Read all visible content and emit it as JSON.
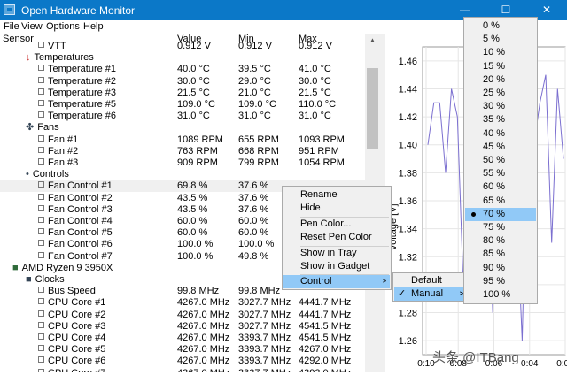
{
  "window": {
    "title": "Open Hardware Monitor",
    "minimize": "—",
    "maximize": "☐",
    "close": "✕"
  },
  "menu": [
    "File",
    "View",
    "Options",
    "Help"
  ],
  "columns": {
    "sensor": "Sensor",
    "value": "Value",
    "min": "Min",
    "max": "Max"
  },
  "rows": [
    {
      "label": "VTT",
      "value": "0.912 V",
      "min": "0.912 V",
      "max": "0.912 V",
      "kind": "leaf"
    },
    {
      "label": "Temperatures",
      "value": "",
      "min": "",
      "max": "",
      "kind": "group",
      "icon": "thermometer-icon"
    },
    {
      "label": "Temperature #1",
      "value": "40.0 °C",
      "min": "39.5 °C",
      "max": "41.0 °C",
      "kind": "leaf"
    },
    {
      "label": "Temperature #2",
      "value": "30.0 °C",
      "min": "29.0 °C",
      "max": "30.0 °C",
      "kind": "leaf"
    },
    {
      "label": "Temperature #3",
      "value": "21.5 °C",
      "min": "21.0 °C",
      "max": "21.5 °C",
      "kind": "leaf"
    },
    {
      "label": "Temperature #5",
      "value": "109.0 °C",
      "min": "109.0 °C",
      "max": "110.0 °C",
      "kind": "leaf"
    },
    {
      "label": "Temperature #6",
      "value": "31.0 °C",
      "min": "31.0 °C",
      "max": "31.0 °C",
      "kind": "leaf"
    },
    {
      "label": "Fans",
      "value": "",
      "min": "",
      "max": "",
      "kind": "group",
      "icon": "fan-icon"
    },
    {
      "label": "Fan #1",
      "value": "1089 RPM",
      "min": "655 RPM",
      "max": "1093 RPM",
      "kind": "leaf"
    },
    {
      "label": "Fan #2",
      "value": "763 RPM",
      "min": "668 RPM",
      "max": "951 RPM",
      "kind": "leaf"
    },
    {
      "label": "Fan #3",
      "value": "909 RPM",
      "min": "799 RPM",
      "max": "1054 RPM",
      "kind": "leaf"
    },
    {
      "label": "Controls",
      "value": "",
      "min": "",
      "max": "",
      "kind": "group",
      "icon": "controls-icon"
    },
    {
      "label": "Fan Control #1",
      "value": "69.8 %",
      "min": "37.6 %",
      "max": "",
      "kind": "leaf",
      "selected": true
    },
    {
      "label": "Fan Control #2",
      "value": "43.5 %",
      "min": "37.6 %",
      "max": "",
      "kind": "leaf"
    },
    {
      "label": "Fan Control #3",
      "value": "43.5 %",
      "min": "37.6 %",
      "max": "",
      "kind": "leaf"
    },
    {
      "label": "Fan Control #4",
      "value": "60.0 %",
      "min": "60.0 %",
      "max": "",
      "kind": "leaf"
    },
    {
      "label": "Fan Control #5",
      "value": "60.0 %",
      "min": "60.0 %",
      "max": "",
      "kind": "leaf"
    },
    {
      "label": "Fan Control #6",
      "value": "100.0 %",
      "min": "100.0 %",
      "max": "",
      "kind": "leaf"
    },
    {
      "label": "Fan Control #7",
      "value": "100.0 %",
      "min": "49.8 %",
      "max": "",
      "kind": "leaf"
    },
    {
      "label": "AMD Ryzen 9 3950X",
      "value": "",
      "min": "",
      "max": "",
      "kind": "device",
      "icon": "cpu-icon"
    },
    {
      "label": "Clocks",
      "value": "",
      "min": "",
      "max": "",
      "kind": "group",
      "icon": "clock-icon"
    },
    {
      "label": "Bus Speed",
      "value": "99.8 MHz",
      "min": "99.8 MHz",
      "max": "",
      "kind": "leaf"
    },
    {
      "label": "CPU Core #1",
      "value": "4267.0 MHz",
      "min": "3027.7 MHz",
      "max": "4441.7 MHz",
      "kind": "leaf"
    },
    {
      "label": "CPU Core #2",
      "value": "4267.0 MHz",
      "min": "3027.7 MHz",
      "max": "4441.7 MHz",
      "kind": "leaf"
    },
    {
      "label": "CPU Core #3",
      "value": "4267.0 MHz",
      "min": "3027.7 MHz",
      "max": "4541.5 MHz",
      "kind": "leaf"
    },
    {
      "label": "CPU Core #4",
      "value": "4267.0 MHz",
      "min": "3393.7 MHz",
      "max": "4541.5 MHz",
      "kind": "leaf"
    },
    {
      "label": "CPU Core #5",
      "value": "4267.0 MHz",
      "min": "3393.7 MHz",
      "max": "4267.0 MHz",
      "kind": "leaf"
    },
    {
      "label": "CPU Core #6",
      "value": "4267.0 MHz",
      "min": "3393.7 MHz",
      "max": "4292.0 MHz",
      "kind": "leaf"
    },
    {
      "label": "CPU Core #7",
      "value": "4267.0 MHz",
      "min": "2327.7 MHz",
      "max": "4292.0 MHz",
      "kind": "leaf"
    }
  ],
  "context_menu": {
    "items": [
      "Rename",
      "Hide",
      "Pen Color...",
      "Reset Pen Color",
      "Show in Tray",
      "Show in Gadget",
      "Control"
    ],
    "control_submenu": [
      "Default",
      "Manual"
    ],
    "manual_submenu": [
      "0 %",
      "5 %",
      "10 %",
      "15 %",
      "20 %",
      "25 %",
      "30 %",
      "35 %",
      "40 %",
      "45 %",
      "50 %",
      "55 %",
      "60 %",
      "65 %",
      "70 %",
      "75 %",
      "80 %",
      "85 %",
      "90 %",
      "95 %",
      "100 %"
    ],
    "manual_selected": "70 %"
  },
  "watermark": "头条 @ITBang",
  "colors": {
    "titlebar": "#0b78c8",
    "highlight": "#91c9f7",
    "plot_line": "#7b6fd0"
  },
  "chart_data": {
    "type": "line",
    "ylabel": "Voltage [V]",
    "yticks": [
      "1.46",
      "1.44",
      "1.42",
      "1.40",
      "1.38",
      "1.36",
      "1.34",
      "1.32",
      "1.30",
      "1.28",
      "1.26"
    ],
    "xticks": [
      "0:10",
      "0:08",
      "0:06",
      "0:04",
      "0:02"
    ],
    "ylim": [
      1.25,
      1.47
    ],
    "series": [
      {
        "values": [
          1.4,
          1.43,
          1.43,
          1.38,
          1.44,
          1.42,
          1.3,
          1.42,
          1.35,
          1.44,
          1.4,
          1.28,
          1.42,
          1.43,
          1.41,
          1.36,
          1.26,
          1.44,
          1.4,
          1.43,
          1.45,
          1.33,
          1.44,
          1.39
        ]
      }
    ]
  }
}
